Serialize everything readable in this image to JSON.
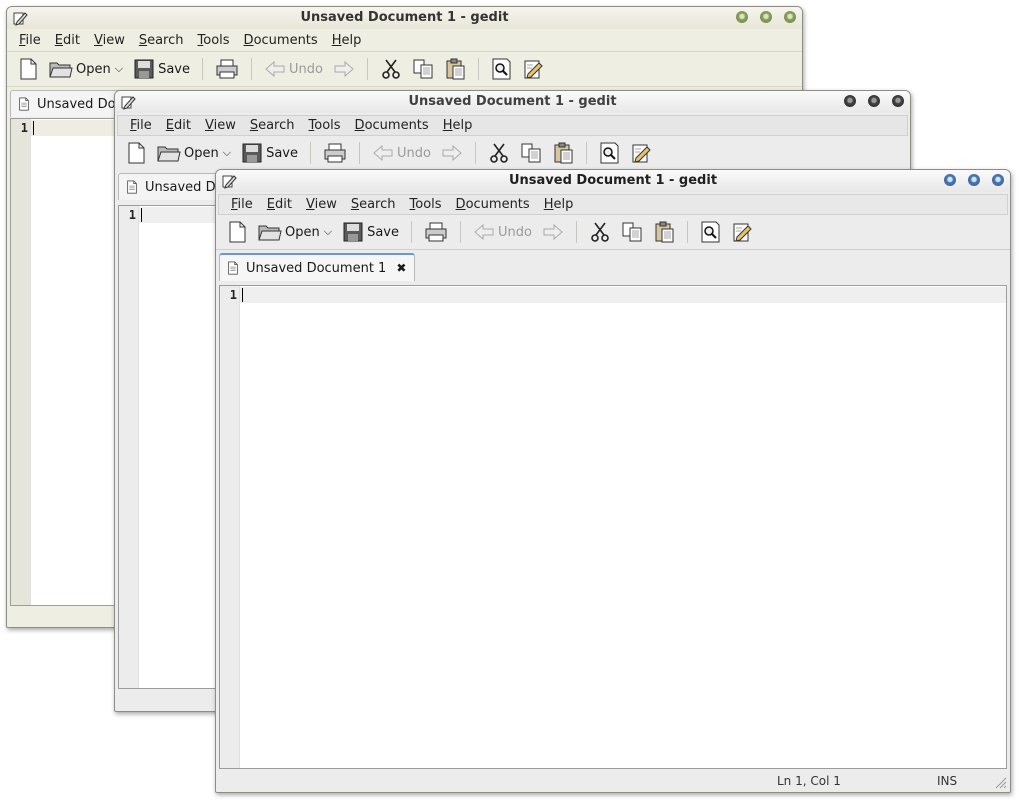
{
  "window_title": "Unsaved Document 1 - gedit",
  "menus": [
    "File",
    "Edit",
    "View",
    "Search",
    "Tools",
    "Documents",
    "Help"
  ],
  "menu_mnemonics": [
    "F",
    "E",
    "V",
    "S",
    "T",
    "D",
    "H"
  ],
  "toolbar": {
    "open_label": "Open",
    "save_label": "Save",
    "undo_label": "Undo"
  },
  "tab": {
    "full_label": "Unsaved Document 1",
    "truncated_label": "Unsaved Doc",
    "truncated_label_2": "Unsaved Do"
  },
  "editor": {
    "line_number": "1"
  },
  "status": {
    "position": "Ln 1, Col 1",
    "mode": "INS"
  },
  "colors": {
    "inactive_window_bg": "#efeee3",
    "active_accent": "#4b7bb3"
  },
  "icons": [
    "document-icon",
    "new-document-icon",
    "open-folder-icon",
    "dropdown-arrow-icon",
    "save-icon",
    "print-icon",
    "undo-icon",
    "redo-icon",
    "cut-icon",
    "copy-icon",
    "paste-icon",
    "find-icon",
    "replace-icon",
    "close-icon",
    "resize-grip-icon"
  ]
}
